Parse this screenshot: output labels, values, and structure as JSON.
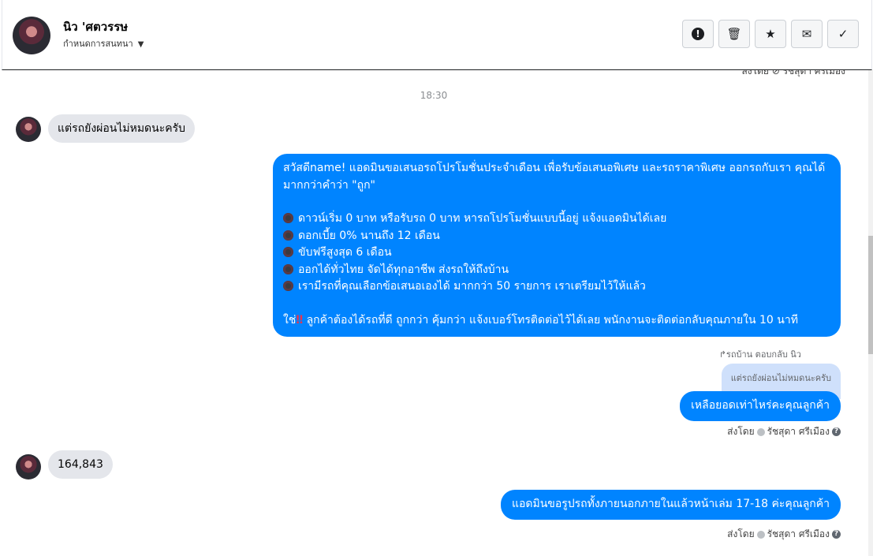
{
  "header": {
    "contact_name": "นิว 'ศตวรรษ",
    "assign_label": "กำหนดการสนทนา",
    "actions": [
      {
        "name": "spam-button",
        "icon": "exclamation-icon",
        "glyph": "!"
      },
      {
        "name": "delete-button",
        "icon": "trash-icon",
        "glyph": "🗑"
      },
      {
        "name": "star-button",
        "icon": "star-icon",
        "glyph": "★"
      },
      {
        "name": "mark-unread-button",
        "icon": "envelope-icon",
        "glyph": "✉"
      },
      {
        "name": "mark-done-button",
        "icon": "checkmark-icon",
        "glyph": "✓"
      }
    ]
  },
  "messages": {
    "top_meta": "ส่งโดย ⊘ รัชสุดา ศรีเมือง",
    "time": "18:30",
    "incoming_1": "แต่รถยังผ่อนไม่หมดนะครับ",
    "promo": {
      "intro": "สวัสดีname! แอดมินขอเสนอรถโปรโมชั่นประจำเดือน เพื่อรับข้อเสนอพิเศษ และรถราคาพิเศษ ออกรถกับเรา คุณได้มากกว่าคำว่า \"ถูก\"",
      "bullets": [
        "ดาวน์เริ่ม 0 บาท หรือรับรถ 0 บาท หารถโปรโมชั่นแบบนี้อยู่ แจ้งแอดมินได้เลย",
        "ดอกเบี้ย 0% นานถึง 12 เดือน",
        "ขับฟรีสูงสุด 6 เดือน",
        "ออกได้ทั่วไทย จัดได้ทุกอาชีพ ส่งรถให้ถึงบ้าน",
        "เรามีรถที่คุณเลือกข้อเสนอเองได้ มากกว่า 50 รายการ เราเตรียมไว้ให้แล้ว"
      ],
      "closing_prefix": "ใช่",
      "closing_mark": "‼",
      "closing_text": " ลูกค้าต้องได้รถที่ดี ถูกกว่า คุ้มกว่า แจ้งเบอร์โทรติดต่อไว้ได้เลย พนักงานจะติดต่อกลับคุณภายใน 10 นาที"
    },
    "reply_label": "↱รถบ้าน ตอบกลับ นิว",
    "quoted_text": "แต่รถยังผ่อนไม่หมดนะครับ",
    "outgoing_2": "เหลือยอดเท่าไหร่คะคุณลูกค้า",
    "meta_2": {
      "sent_by": "ส่งโดย",
      "agent": "รัชสุดา ศรีเมือง"
    },
    "incoming_2": "164,843",
    "outgoing_3": "แอดมินขอรูปรถทั้งภายนอกภายในแล้วหน้าเล่ม 17-18  ค่ะคุณลูกค้า",
    "meta_3": {
      "sent_by": "ส่งโดย",
      "agent": "รัชสุดา ศรีเมือง"
    }
  },
  "colors": {
    "outgoing_bubble": "#0084ff",
    "incoming_bubble": "#e4e6eb",
    "quoted_bubble": "#cfe0fb"
  }
}
